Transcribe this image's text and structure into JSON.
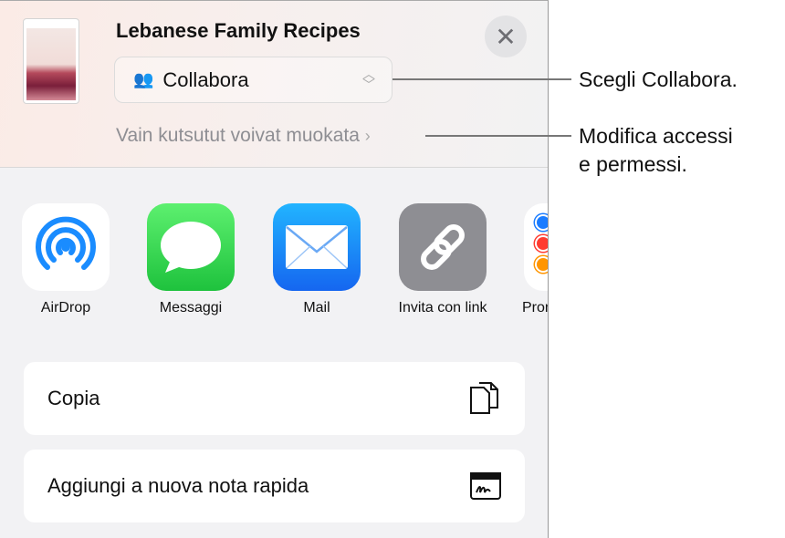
{
  "sheet": {
    "title": "Lebanese Family Recipes",
    "close_icon": "xmark-icon",
    "collab_select": {
      "value": "Collabora",
      "icon": "people-icon",
      "chevron": "up-down-chevron-icon"
    },
    "permissions_link": "Vain kutsutut voivat muokata",
    "apps": [
      {
        "label": "AirDrop",
        "icon": "airdrop-icon",
        "color": "#1a8cff"
      },
      {
        "label": "Messaggi",
        "icon": "messages-icon",
        "color": "#2fc84d"
      },
      {
        "label": "Mail",
        "icon": "mail-icon",
        "color": "#1f7cf5"
      },
      {
        "label": "Invita con link",
        "icon": "link-icon",
        "color": "#8e8e93"
      },
      {
        "label": "Promemoria",
        "icon": "reminders-icon",
        "color": "#ffffff"
      }
    ],
    "actions": [
      {
        "label": "Copia",
        "icon": "copy-icon"
      },
      {
        "label": "Aggiungi a nuova nota rapida",
        "icon": "quick-note-icon"
      }
    ]
  },
  "callouts": {
    "collab": "Scegli Collabora.",
    "perm_line1": "Modifica accessi",
    "perm_line2": "e permessi."
  }
}
